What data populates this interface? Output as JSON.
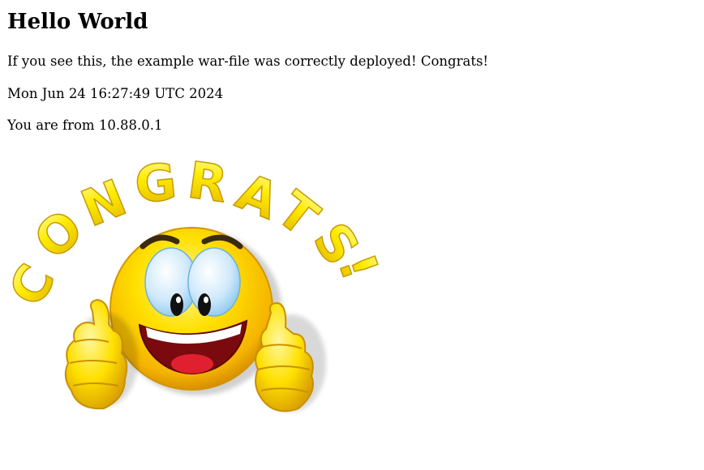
{
  "page": {
    "heading": "Hello World",
    "message": "If you see this, the example war-file was correctly deployed! Congrats!",
    "timestamp": "Mon Jun 24 16:27:49 UTC 2024",
    "client_ip_text": "You are from 10.88.0.1"
  },
  "image": {
    "icon": "congrats-smiley-thumbs-up",
    "banner_letters": [
      "C",
      "O",
      "N",
      "G",
      "R",
      "A",
      "T",
      "S",
      "!"
    ]
  },
  "colors": {
    "smiley_yellow": "#ffd800",
    "letter_yellow": "#ffe600",
    "mouth_red": "#c0101a",
    "eye_blue": "#9fd3f5",
    "text": "#000000",
    "background": "#ffffff"
  }
}
